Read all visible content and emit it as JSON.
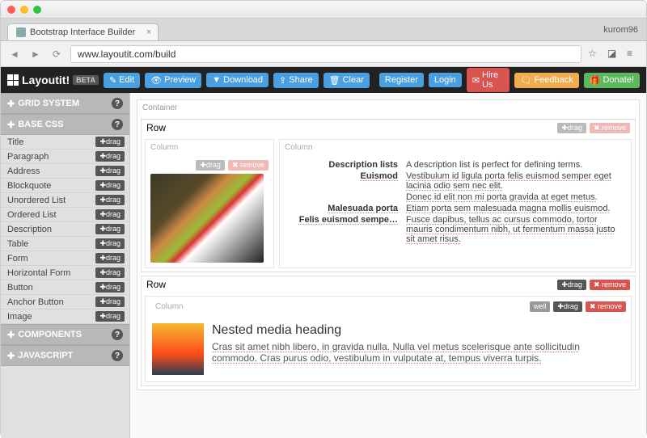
{
  "browser": {
    "tab_title": "Bootstrap Interface Builder",
    "url": "www.layoutit.com/build",
    "user": "kurom96"
  },
  "app": {
    "brand": "Layoutit!",
    "beta": "BETA",
    "toolbar": {
      "edit": "Edit",
      "preview": "Preview",
      "download": "Download",
      "share": "Share",
      "clear": "Clear"
    },
    "right": {
      "register": "Register",
      "login": "Login",
      "hire": "Hire Us",
      "feedback": "Feedback",
      "donate": "Donate!"
    }
  },
  "sidebar": {
    "headers": {
      "grid": "GRID SYSTEM",
      "base": "BASE CSS",
      "components": "COMPONENTS",
      "javascript": "JAVASCRIPT"
    },
    "drag_label": "drag",
    "base_items": [
      "Title",
      "Paragraph",
      "Address",
      "Blockquote",
      "Unordered List",
      "Ordered List",
      "Description",
      "Table",
      "Form",
      "Horizontal Form",
      "Button",
      "Anchor Button",
      "Image"
    ]
  },
  "canvas": {
    "container": "Container",
    "row": "Row",
    "column": "Column",
    "drag": "drag",
    "remove": "remove",
    "well": "well",
    "dl": {
      "t1": "Description lists",
      "d1": "A description list is perfect for defining terms.",
      "t2": "Euismod",
      "d2": "Vestibulum id ligula porta felis euismod semper eget lacinia odio sem nec elit.",
      "d2b": "Donec id elit non mi porta gravida at eget metus.",
      "t3": "Malesuada porta",
      "d3": "Etiam porta sem malesuada magna mollis euismod.",
      "t4": "Felis euismod sempe…",
      "d4": "Fusce dapibus, tellus ac cursus commodo, tortor mauris condimentum nibh, ut fermentum massa justo sit amet risus."
    },
    "media": {
      "heading": "Nested media heading",
      "body": "Cras sit amet nibh libero, in gravida nulla. Nulla vel metus scelerisque ante sollicitudin commodo. Cras purus odio, vestibulum in vulputate at, tempus viverra turpis."
    }
  }
}
